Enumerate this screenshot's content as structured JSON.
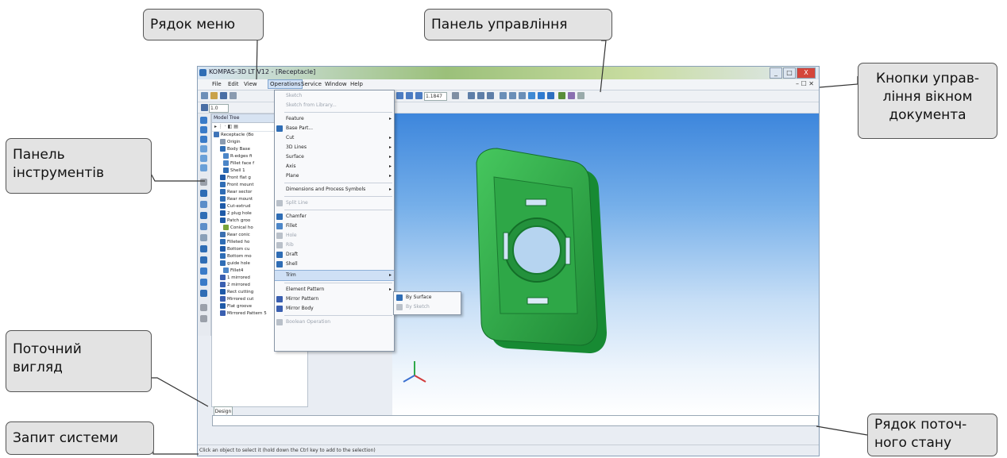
{
  "app": {
    "title": "KOMPAS-3D LT V12 - [Receptacle]",
    "window_buttons": [
      "_",
      "□",
      "X"
    ],
    "doc_buttons": "– ☐ ✕",
    "menu": [
      {
        "label": "File"
      },
      {
        "label": "Edit"
      },
      {
        "label": "View"
      },
      {
        "label": "Operations"
      },
      {
        "label": "Service"
      },
      {
        "label": "Window"
      },
      {
        "label": "Help"
      }
    ],
    "zoom_value": "1.1847",
    "line_width": "1.0",
    "tree": {
      "header": "Model Tree",
      "items": [
        "Receptacle (Bo",
        "Origin",
        "Body Base",
        "R-edges fi",
        "Fillet face f",
        "Shell 1",
        "Front flat g",
        "Front mount",
        "Rear sector",
        "Rear mount",
        "Cut-extrud",
        "2 plug hole",
        "Patch groo",
        "Conical ho",
        "Rear conic",
        "Filleted ho",
        "Bottom cu",
        "Bottom mo",
        "guide hole",
        "Fillet4",
        "1 mirrored",
        "2 mirrored",
        "Rect cutting",
        "Mirrored cut",
        "Flat groove",
        "Mirrored Pattern 5"
      ],
      "design_tab": "Design"
    },
    "operations_menu": [
      {
        "label": "Sketch",
        "disabled": true
      },
      {
        "label": "Sketch from Library...",
        "disabled": true
      },
      {
        "label": "Feature",
        "arrow": true
      },
      {
        "label": "Base Part...",
        "icon": true
      },
      {
        "label": "Cut",
        "arrow": true
      },
      {
        "label": "3D Lines",
        "arrow": true
      },
      {
        "label": "Surface",
        "arrow": true
      },
      {
        "label": "Axis",
        "arrow": true
      },
      {
        "label": "Plane",
        "arrow": true
      },
      {
        "label": "Dimensions and Process Symbols",
        "arrow": true
      },
      {
        "label": "Split Line",
        "disabled": true
      },
      {
        "label": "Chamfer",
        "icon": true
      },
      {
        "label": "Fillet",
        "icon": true
      },
      {
        "label": "Hole",
        "disabled": true
      },
      {
        "label": "Rib",
        "disabled": true
      },
      {
        "label": "Draft",
        "icon": true
      },
      {
        "label": "Shell",
        "icon": true
      },
      {
        "label": "Trim",
        "arrow": true,
        "highlight": true
      },
      {
        "label": "Element Pattern",
        "arrow": true
      },
      {
        "label": "Mirror Pattern",
        "icon": true
      },
      {
        "label": "Mirror Body",
        "icon": true
      },
      {
        "label": "Boolean Operation",
        "disabled": true
      }
    ],
    "trim_submenu": [
      {
        "label": "By Surface"
      },
      {
        "label": "By Sketch",
        "disabled": true
      }
    ],
    "status_prompt": "Click an object to select it (hold down the Ctrl key to add to the selection)"
  },
  "callouts": {
    "menu_bar": "Рядок меню",
    "control_panel": "Панель управління",
    "window_buttons": [
      "Кнопки управ-",
      "ління вікном",
      "документа"
    ],
    "toolbar": [
      "Панель",
      "інструментів"
    ],
    "current_view": [
      "Поточний",
      "вигляд"
    ],
    "system_prompt": "Запит системи",
    "status_line": [
      "Рядок поточ-",
      "ного стану"
    ]
  },
  "colors": {
    "model_green": "#2eaa46",
    "viewport_top": "#3d86dc",
    "callout_bg": "#e3e3e3"
  }
}
